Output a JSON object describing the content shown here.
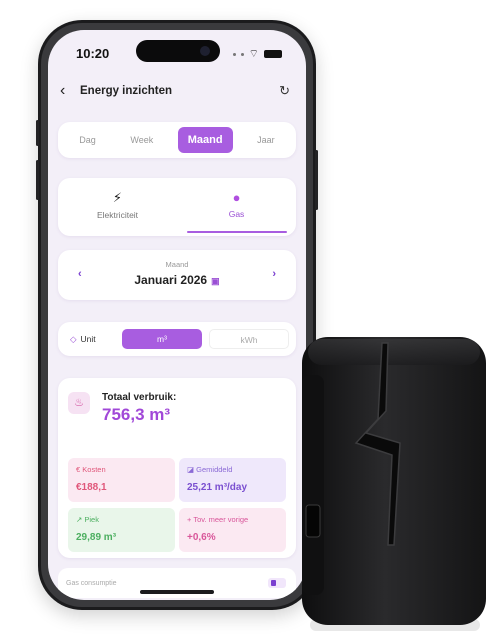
{
  "status": {
    "time": "10:20"
  },
  "header": {
    "title": "Energy inzichten"
  },
  "periods": {
    "dag": "Dag",
    "week": "Week",
    "maand": "Maand",
    "jaar": "Jaar"
  },
  "types": {
    "elektriciteit": "Elektriciteit",
    "gas": "Gas"
  },
  "month": {
    "label": "Maand",
    "value": "Januari 2026"
  },
  "unit": {
    "label": "Unit",
    "m3": "m³",
    "kwh": "kWh"
  },
  "total": {
    "label": "Totaal verbruik:",
    "value": "756,3 m³"
  },
  "stats": {
    "kosten": {
      "label": "Kosten",
      "value": "€188,1"
    },
    "gemiddeld": {
      "label": "Gemiddeld",
      "value": "25,21 m³/day"
    },
    "piek": {
      "label": "Piek",
      "value": "29,89 m³"
    },
    "tov": {
      "label": "Tov. meer vorige",
      "value": "+0,6%"
    }
  },
  "chart": {
    "title": "Gas consumptie"
  },
  "colors": {
    "accent": "#a85de0",
    "background": "#f3eff8",
    "device": "#1a1a1a"
  }
}
